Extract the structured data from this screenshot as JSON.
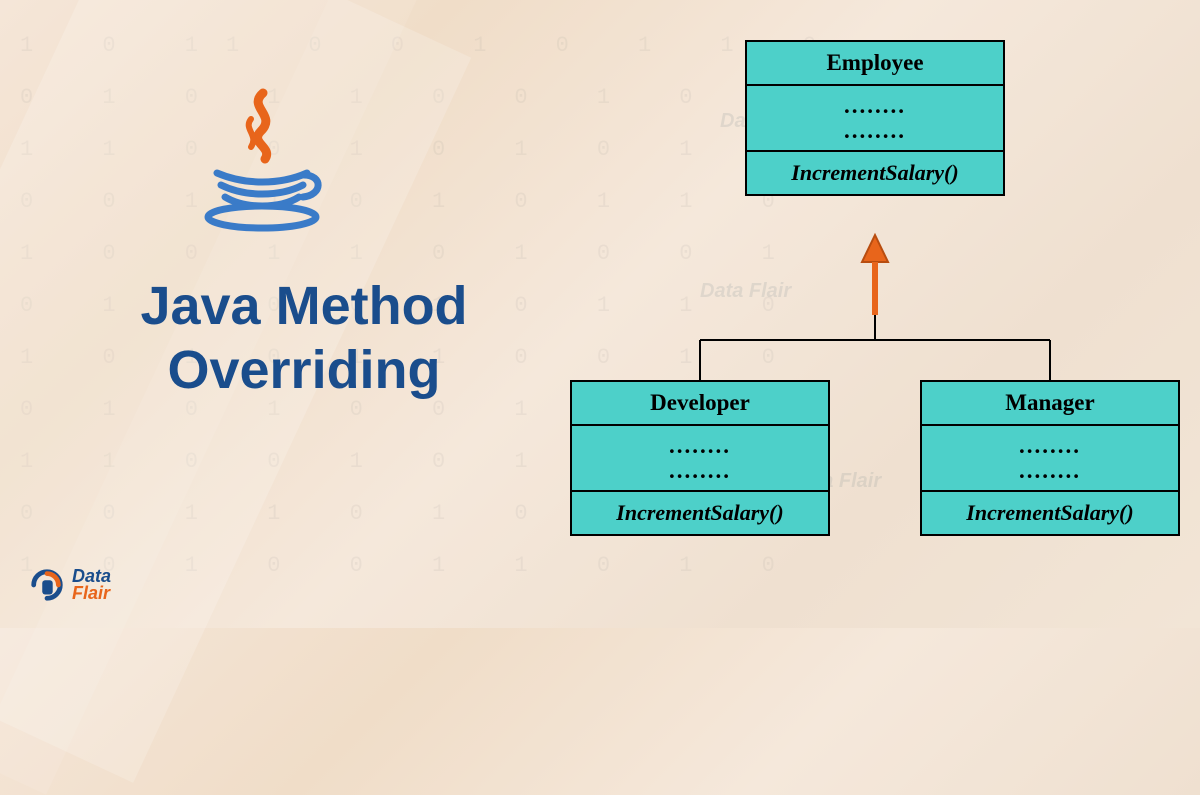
{
  "title_line1": "Java Method",
  "title_line2": "Overriding",
  "logo": {
    "data": "Data",
    "flair": "Flair"
  },
  "diagram": {
    "parent": {
      "name": "Employee",
      "ellipsis1": "........",
      "ellipsis2": "........",
      "method": "IncrementSalary()"
    },
    "children": [
      {
        "name": "Developer",
        "ellipsis1": "........",
        "ellipsis2": "........",
        "method": "IncrementSalary()"
      },
      {
        "name": "Manager",
        "ellipsis1": "........",
        "ellipsis2": "........",
        "method": "IncrementSalary()"
      }
    ]
  },
  "binary_pattern": "1 0 11 0 0 1 0 1 1 0\n0 1 0 1 1 0 0 1 0 1\n1 1 0 0 1 0 1 0 1 0\n0 0 1 1 0 1 0 1 1 0\n1 0 0 1 1 0 1 0 0 1\n0 1 1 0 0 1 0 1 1 0\n1 0 1 0 1 1 0 0 1 0\n0 1 0 1 0 0 1 1 0 1\n1 1 0 0 1 0 1 0 11 0\n0 0 1 1 0 1 0 1 0 1\n1 0 1 0 0 1 1 0 1 0"
}
